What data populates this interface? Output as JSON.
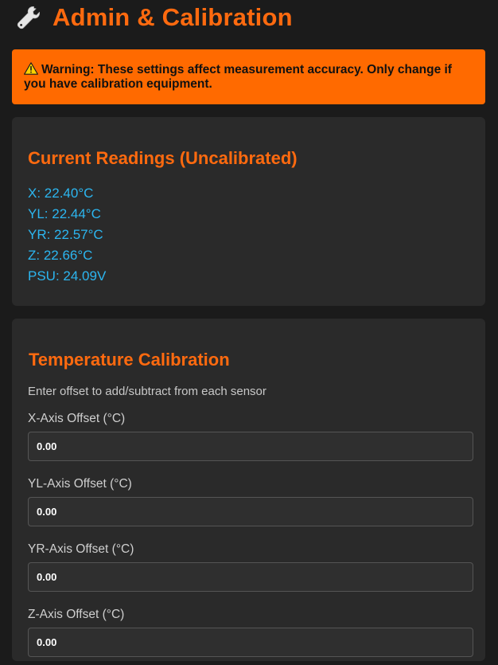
{
  "header": {
    "icon": "wrench-icon",
    "title": "Admin & Calibration"
  },
  "warning": {
    "icon": "warning-triangle-icon",
    "text": "Warning: These settings affect measurement accuracy. Only change if you have calibration equipment."
  },
  "readings": {
    "title": "Current Readings (Uncalibrated)",
    "items": [
      "X: 22.40°C",
      "YL: 22.44°C",
      "YR: 22.57°C",
      "Z: 22.66°C",
      "PSU: 24.09V"
    ],
    "color": "#2cb6f0"
  },
  "calibration": {
    "title": "Temperature Calibration",
    "hint": "Enter offset to add/subtract from each sensor",
    "fields": [
      {
        "label": "X-Axis Offset (°C)",
        "value": "0.00"
      },
      {
        "label": "YL-Axis Offset (°C)",
        "value": "0.00"
      },
      {
        "label": "YR-Axis Offset (°C)",
        "value": "0.00"
      },
      {
        "label": "Z-Axis Offset (°C)",
        "value": "0.00"
      }
    ]
  },
  "colors": {
    "accent": "#ff6a0f",
    "warning_bg": "#ff6a00",
    "background": "#1b1b1b",
    "card": "#2a2a2a"
  }
}
